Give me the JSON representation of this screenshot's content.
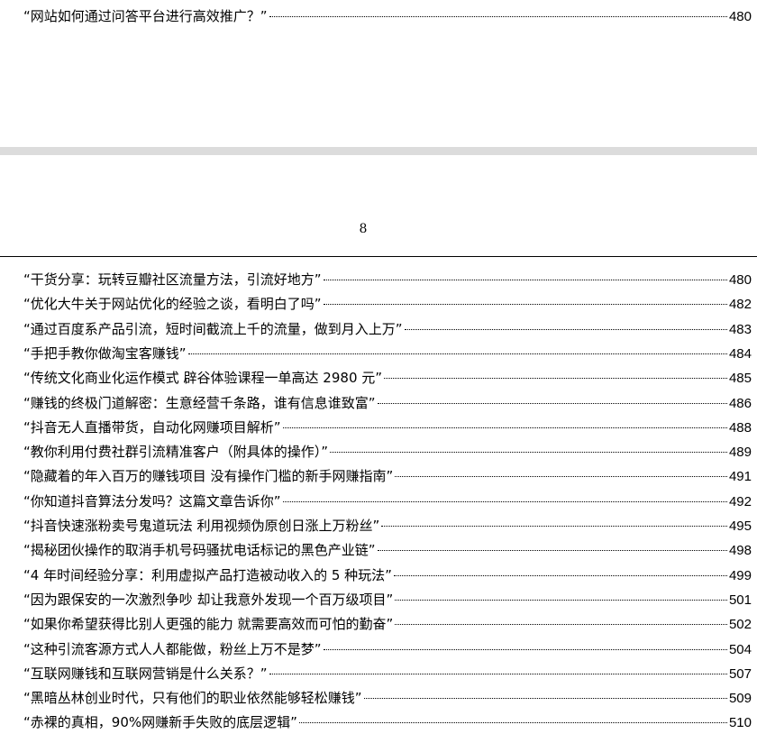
{
  "previous_page": {
    "entries": [
      {
        "title": "“网站如何通过问答平台进行高效推广？”",
        "page": "480"
      }
    ]
  },
  "current_page": {
    "page_number": "8",
    "entries": [
      {
        "title": "“干货分享：玩转豆瓣社区流量方法，引流好地方”",
        "page": "480"
      },
      {
        "title": "“优化大牛关于网站优化的经验之谈，看明白了吗”",
        "page": "482"
      },
      {
        "title": "“通过百度系产品引流，短时间截流上千的流量，做到月入上万”",
        "page": "483"
      },
      {
        "title": "“手把手教你做淘宝客赚钱”",
        "page": "484"
      },
      {
        "title": "“传统文化商业化运作模式 辟谷体验课程一单高达 2980 元”",
        "page": "485"
      },
      {
        "title": "“赚钱的终极门道解密：生意经营千条路，谁有信息谁致富”",
        "page": "486"
      },
      {
        "title": "“抖音无人直播带货，自动化网赚项目解析”",
        "page": "488"
      },
      {
        "title": "“教你利用付费社群引流精准客户（附具体的操作）”",
        "page": "489"
      },
      {
        "title": "“隐藏着的年入百万的赚钱项目 没有操作门槛的新手网赚指南”",
        "page": "491"
      },
      {
        "title": "“你知道抖音算法分发吗？这篇文章告诉你”",
        "page": "492"
      },
      {
        "title": "“抖音快速涨粉卖号鬼道玩法 利用视频伪原创日涨上万粉丝”",
        "page": "495"
      },
      {
        "title": "“揭秘团伙操作的取消手机号码骚扰电话标记的黑色产业链”",
        "page": "498"
      },
      {
        "title": "“4 年时间经验分享：利用虚拟产品打造被动收入的 5 种玩法”",
        "page": "499"
      },
      {
        "title": "“因为跟保安的一次激烈争吵 却让我意外发现一个百万级项目”",
        "page": "501"
      },
      {
        "title": "“如果你希望获得比别人更强的能力 就需要高效而可怕的勤奋”",
        "page": "502"
      },
      {
        "title": "“这种引流客源方式人人都能做，粉丝上万不是梦”",
        "page": "504"
      },
      {
        "title": "“互联网赚钱和互联网营销是什么关系？”",
        "page": "507"
      },
      {
        "title": "“黑暗丛林创业时代，只有他们的职业依然能够轻松赚钱”",
        "page": "509"
      },
      {
        "title": "“赤裸的真相，90%网赚新手失败的底层逻辑”",
        "page": "510"
      }
    ]
  }
}
